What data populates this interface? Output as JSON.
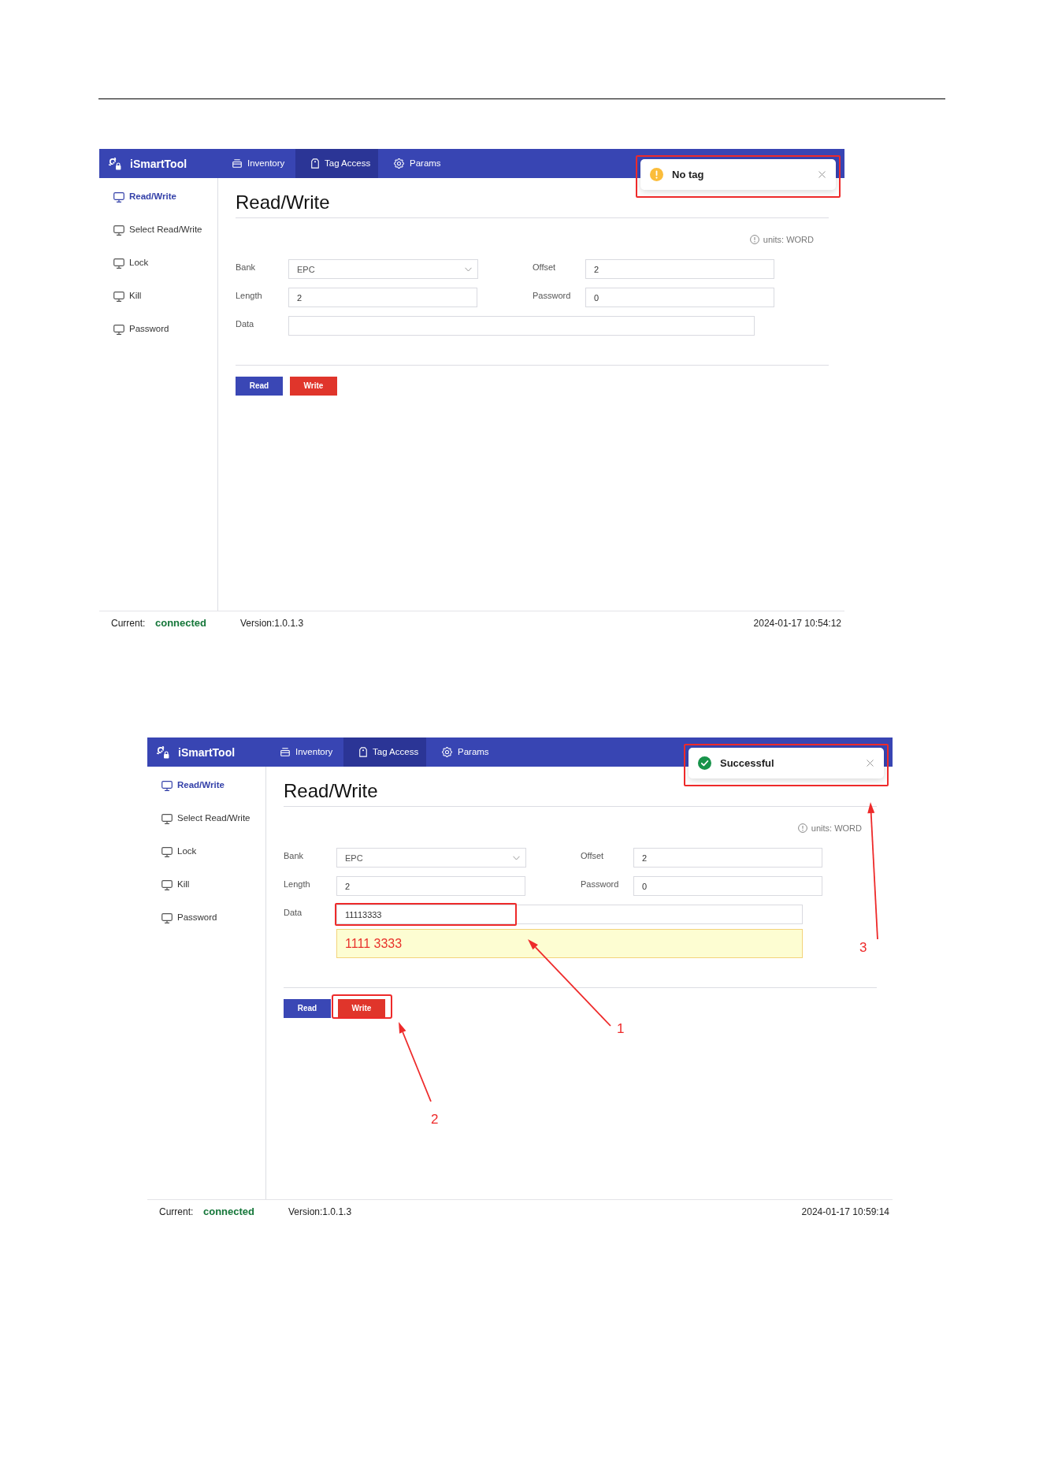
{
  "screenshots": [
    {
      "header": {
        "app_name": "iSmartTool",
        "tabs": [
          {
            "label": "Inventory",
            "selected": false
          },
          {
            "label": "Tag Access",
            "selected": true
          },
          {
            "label": "Params",
            "selected": false
          }
        ]
      },
      "sidebar": {
        "items": [
          {
            "label": "Read/Write",
            "selected": true
          },
          {
            "label": "Select Read/Write",
            "selected": false
          },
          {
            "label": "Lock",
            "selected": false
          },
          {
            "label": "Kill",
            "selected": false
          },
          {
            "label": "Password",
            "selected": false
          }
        ]
      },
      "page_title": "Read/Write",
      "units_note": "units: WORD",
      "form": {
        "fields": [
          {
            "label": "Bank",
            "kind": "select",
            "value": "EPC",
            "highlighted": false
          },
          {
            "label": "Offset",
            "kind": "input",
            "value": "2",
            "highlighted": false
          },
          {
            "label": "Length",
            "kind": "input",
            "value": "2",
            "highlighted": false
          },
          {
            "label": "Password",
            "kind": "input",
            "value": "0",
            "highlighted": false
          },
          {
            "label": "Data",
            "kind": "input",
            "highlighted": false
          }
        ]
      },
      "buttons": [
        {
          "label": "Read",
          "kind": "primary",
          "highlighted": false
        },
        {
          "label": "Write",
          "kind": "danger",
          "highlighted": false
        }
      ],
      "toast": {
        "kind": "warning",
        "message": "No tag",
        "highlighted": true
      },
      "status_bar": {
        "label": "Current:",
        "connection": "connected",
        "version": "Version:1.0.1.3",
        "datetime": "2024-01-17 10:54:12"
      }
    },
    {
      "header": {
        "app_name": "iSmartTool",
        "tabs": [
          {
            "label": "Inventory",
            "selected": false
          },
          {
            "label": "Tag Access",
            "selected": true
          },
          {
            "label": "Params",
            "selected": false
          }
        ]
      },
      "sidebar": {
        "items": [
          {
            "label": "Read/Write",
            "selected": true
          },
          {
            "label": "Select Read/Write",
            "selected": false
          },
          {
            "label": "Lock",
            "selected": false
          },
          {
            "label": "Kill",
            "selected": false
          },
          {
            "label": "Password",
            "selected": false
          }
        ]
      },
      "page_title": "Read/Write",
      "units_note": "units: WORD",
      "form": {
        "fields": [
          {
            "label": "Bank",
            "kind": "select",
            "value": "EPC",
            "highlighted": false
          },
          {
            "label": "Offset",
            "kind": "input",
            "value": "2",
            "highlighted": false
          },
          {
            "label": "Length",
            "kind": "input",
            "value": "2",
            "highlighted": false
          },
          {
            "label": "Password",
            "kind": "input",
            "value": "0",
            "highlighted": false
          },
          {
            "label": "Data",
            "kind": "input",
            "value": "11113333",
            "preview": "1111 3333",
            "highlighted": true
          }
        ]
      },
      "buttons": [
        {
          "label": "Read",
          "kind": "primary",
          "highlighted": false
        },
        {
          "label": "Write",
          "kind": "danger",
          "highlighted": true
        }
      ],
      "toast": {
        "kind": "success",
        "message": "Successful",
        "highlighted": true
      },
      "status_bar": {
        "label": "Current:",
        "connection": "connected",
        "version": "Version:1.0.1.3",
        "datetime": "2024-01-17 10:59:14"
      },
      "annotations": [
        {
          "label": "1"
        },
        {
          "label": "2"
        },
        {
          "label": "3"
        }
      ]
    }
  ]
}
